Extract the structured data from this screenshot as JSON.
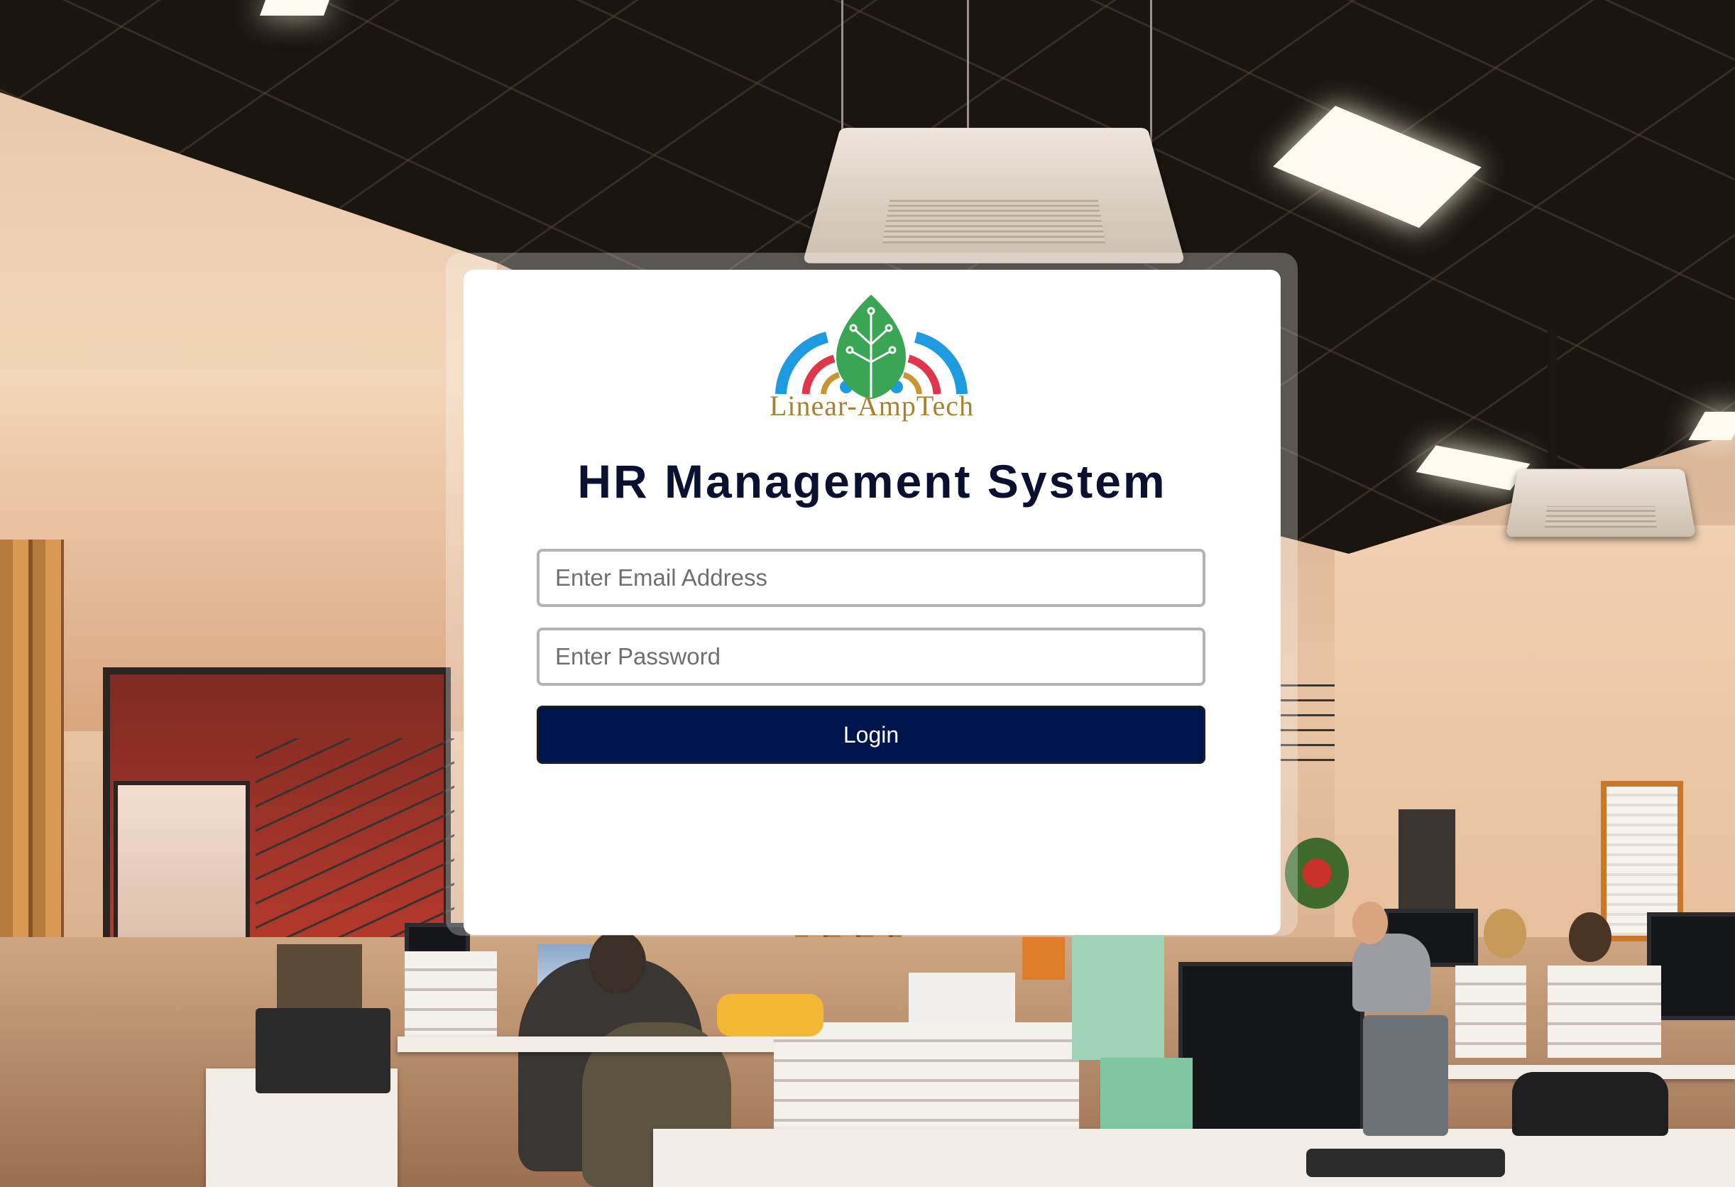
{
  "brand": {
    "name": "Linear-AmpTech"
  },
  "login": {
    "title": "HR Management System",
    "email_placeholder": "Enter Email Address",
    "password_placeholder": "Enter Password",
    "submit_label": "Login"
  },
  "colors": {
    "primary_button": "#00154b",
    "title_text": "#0c1030",
    "brand_text": "#a9822f",
    "logo_leaf": "#3aa655",
    "logo_blue": "#1e9be0",
    "logo_red": "#e0364a",
    "logo_gold": "#c9952e"
  },
  "background": {
    "subject": "office-interior-photo"
  }
}
